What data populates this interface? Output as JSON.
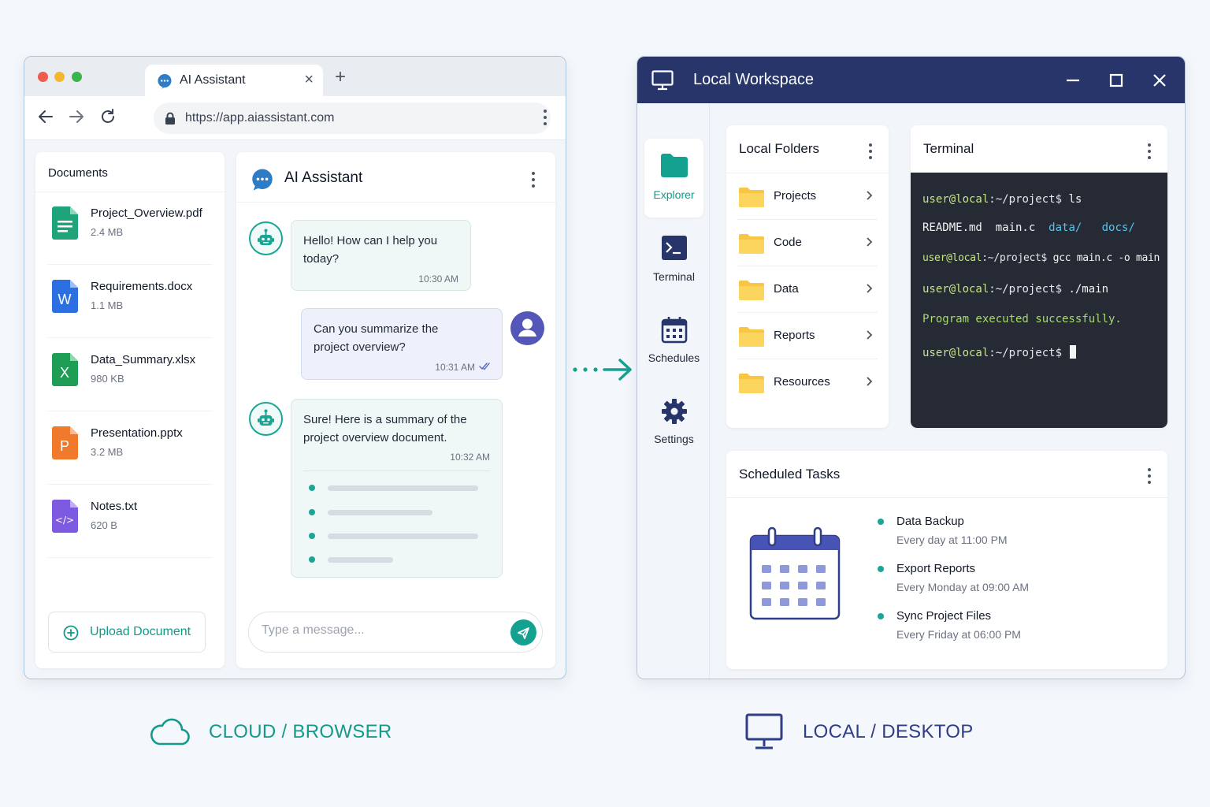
{
  "colors": {
    "teal": "#15a190",
    "navy": "#27356b",
    "indigo": "#5557b8"
  },
  "browser": {
    "tab": {
      "title": "AI Assistant",
      "icon": "chat-bubble-icon"
    },
    "url": "https://app.aiassistant.com",
    "documents": {
      "title": "Documents",
      "files": [
        {
          "name": "Project_Overview.pdf",
          "size": "2.4 MB",
          "icon": "google-doc-icon",
          "color": "#1fa37a"
        },
        {
          "name": "Requirements.docx",
          "size": "1.1 MB",
          "icon": "word-icon",
          "color": "#2b6fe0",
          "letter": "W"
        },
        {
          "name": "Data_Summary.xlsx",
          "size": "980 KB",
          "icon": "excel-icon",
          "color": "#1e9e55",
          "letter": "X"
        },
        {
          "name": "Presentation.pptx",
          "size": "3.2 MB",
          "icon": "powerpoint-icon",
          "color": "#f0792b",
          "letter": "P"
        },
        {
          "name": "Notes.txt",
          "size": "620 B",
          "icon": "code-file-icon",
          "color": "#7d5ae0",
          "letter": "</>"
        }
      ],
      "upload_label": "Upload Document"
    },
    "chat": {
      "title": "AI Assistant",
      "messages": [
        {
          "from": "bot",
          "text": "Hello! How can I help you today?",
          "time": "10:30 AM"
        },
        {
          "from": "user",
          "text": "Can you summarize the project overview?",
          "time": "10:31 AM"
        },
        {
          "from": "bot",
          "text": "Sure! Here is a summary of the project overview document.",
          "time": "10:32 AM"
        }
      ],
      "input_placeholder": "Type a message..."
    }
  },
  "desktop": {
    "title": "Local Workspace",
    "sidebar": [
      {
        "label": "Explorer",
        "icon": "folder-icon",
        "active": true
      },
      {
        "label": "Terminal",
        "icon": "terminal-icon",
        "active": false
      },
      {
        "label": "Schedules",
        "icon": "calendar-icon",
        "active": false
      },
      {
        "label": "Settings",
        "icon": "gear-icon",
        "active": false
      }
    ],
    "folders": {
      "title": "Local Folders",
      "items": [
        "Projects",
        "Code",
        "Data",
        "Reports",
        "Resources"
      ]
    },
    "terminal": {
      "title": "Terminal",
      "prompt_user": "user@local",
      "prompt_path": ":~/project$",
      "lines": {
        "cmd1": " ls",
        "ls_files": "README.md  main.c",
        "ls_dir1": "data/",
        "ls_dir2": "docs/",
        "cmd2": " gcc main.c -o main",
        "cmd3": " ./main",
        "output": "Program executed successfully."
      }
    },
    "tasks": {
      "title": "Scheduled Tasks",
      "items": [
        {
          "name": "Data Backup",
          "schedule": "Every day at 11:00 PM"
        },
        {
          "name": "Export Reports",
          "schedule": "Every Monday at 09:00 AM"
        },
        {
          "name": "Sync Project Files",
          "schedule": "Every Friday at 06:00 PM"
        }
      ]
    }
  },
  "captions": {
    "cloud": "CLOUD / BROWSER",
    "local": "LOCAL / DESKTOP"
  }
}
